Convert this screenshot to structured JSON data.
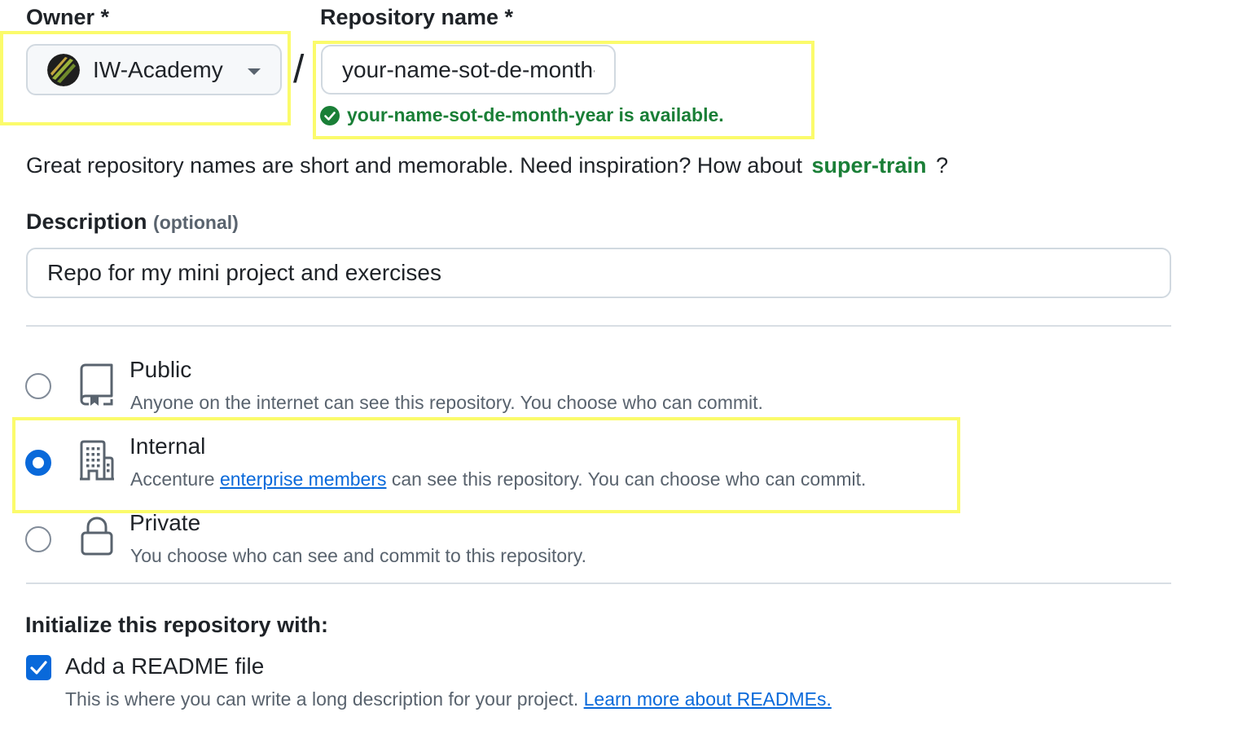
{
  "owner": {
    "label": "Owner *",
    "selected": "IW-Academy"
  },
  "repo": {
    "label": "Repository name *",
    "value": "your-name-sot-de-month-year",
    "availability": "your-name-sot-de-month-year is available."
  },
  "separator": "/",
  "hint": {
    "text": "Great repository names are short and memorable. Need inspiration? How about",
    "suggestion": "super-train",
    "suffix": "?"
  },
  "description": {
    "label": "Description",
    "optional": "(optional)",
    "value": "Repo for my mini project and exercises"
  },
  "visibility": {
    "selected": "internal",
    "options": [
      {
        "id": "public",
        "title": "Public",
        "desc": "Anyone on the internet can see this repository. You choose who can commit.",
        "icon": "repo-icon"
      },
      {
        "id": "internal",
        "title": "Internal",
        "desc_prefix": "Accenture",
        "desc_link": "enterprise members",
        "desc_suffix": "can see this repository. You can choose who can commit.",
        "icon": "organization-icon"
      },
      {
        "id": "private",
        "title": "Private",
        "desc": "You choose who can see and commit to this repository.",
        "icon": "lock-icon"
      }
    ]
  },
  "initialize": {
    "label": "Initialize this repository with:",
    "readme_label": "Add a README file",
    "readme_checked": true,
    "readme_desc": "This is where you can write a long description for your project.",
    "readme_link": "Learn more about READMEs."
  },
  "colors": {
    "accent": "#0969da",
    "success": "#1a7f37",
    "highlight": "#fbfb6b"
  }
}
